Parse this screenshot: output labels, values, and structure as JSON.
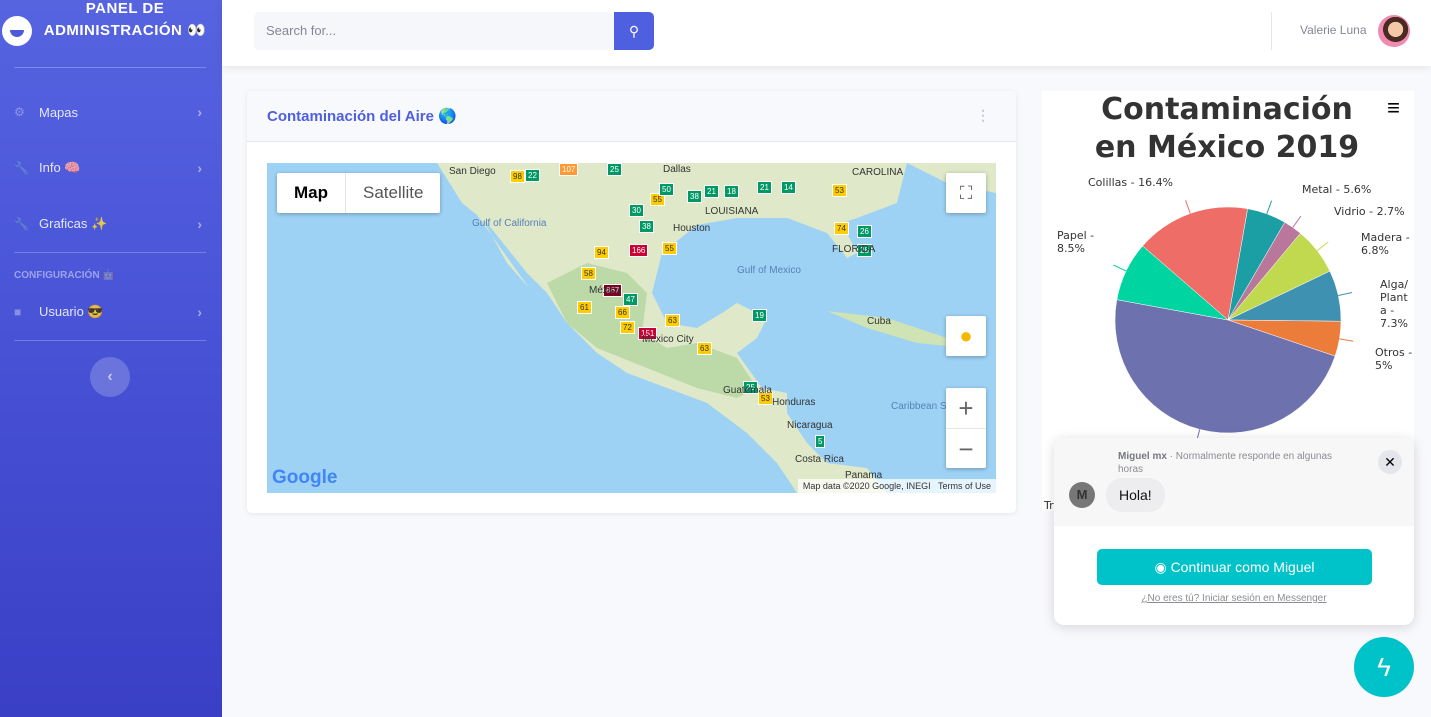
{
  "sidebar": {
    "brand": "PANEL DE ADMINISTRACIÓN 👀",
    "items": [
      {
        "label": "Mapas",
        "icon": "gear-icon"
      },
      {
        "label": "Info 🧠",
        "icon": "wrench-icon"
      },
      {
        "label": "Graficas ✨",
        "icon": "wrench-icon"
      },
      {
        "label": "Usuario 😎",
        "icon": "folder-icon"
      }
    ],
    "heading": "CONFIGURACIÓN 🤖",
    "toggle": "‹"
  },
  "topbar": {
    "search_placeholder": "Search for...",
    "user": "Valerie Luna"
  },
  "map_card": {
    "title": "Contaminación del Aire 🌎",
    "map_types": [
      "Map",
      "Satellite"
    ],
    "zoom_in": "+",
    "zoom_out": "−",
    "attribution": "Map data ©2020 Google, INEGI",
    "terms": "Terms of Use",
    "google": "Google",
    "places": [
      [
        "San Diego",
        182,
        3,
        ""
      ],
      [
        "Dallas",
        396,
        1,
        ""
      ],
      [
        "Houston",
        406,
        60,
        ""
      ],
      [
        "LOUISIANA",
        438,
        43,
        ""
      ],
      [
        "CAROLINA",
        585,
        4,
        ""
      ],
      [
        "FLORIDA",
        565,
        81,
        ""
      ],
      [
        "Gulf of California",
        205,
        55,
        "water"
      ],
      [
        "Gulf of Mexico",
        470,
        102,
        "water"
      ],
      [
        "Cuba",
        600,
        153,
        ""
      ],
      [
        "Guatemala",
        456,
        222,
        ""
      ],
      [
        "Honduras",
        505,
        234,
        ""
      ],
      [
        "Nicaragua",
        520,
        257,
        ""
      ],
      [
        "Costa Rica",
        528,
        291,
        ""
      ],
      [
        "Panama",
        578,
        307,
        ""
      ],
      [
        "Caribbean Sea",
        624,
        238,
        "water"
      ],
      [
        "Mexico City",
        375,
        171,
        ""
      ],
      [
        "México",
        322,
        122,
        ""
      ]
    ],
    "markers": [
      [
        "98",
        243,
        7,
        "#ffcc00"
      ],
      [
        "22",
        258,
        6,
        "#009966"
      ],
      [
        "107",
        292,
        0,
        "#ff9933"
      ],
      [
        "25",
        340,
        0,
        "#009966"
      ],
      [
        "50",
        392,
        20,
        "#009966"
      ],
      [
        "55",
        383,
        30,
        "#ffcc00"
      ],
      [
        "38",
        420,
        27,
        "#009966"
      ],
      [
        "21",
        437,
        22,
        "#009966"
      ],
      [
        "18",
        457,
        22,
        "#009966"
      ],
      [
        "21",
        490,
        18,
        "#009966"
      ],
      [
        "14",
        514,
        18,
        "#009966"
      ],
      [
        "53",
        565,
        21,
        "#ffcc00"
      ],
      [
        "30",
        362,
        41,
        "#009966"
      ],
      [
        "74",
        567,
        59,
        "#ffcc00"
      ],
      [
        "26",
        590,
        62,
        "#009966"
      ],
      [
        "28",
        590,
        81,
        "#009966"
      ],
      [
        "38",
        372,
        57,
        "#009966"
      ],
      [
        "55",
        395,
        79,
        "#ffcc00"
      ],
      [
        "94",
        327,
        83,
        "#ffcc00"
      ],
      [
        "166",
        362,
        81,
        "#cc0033"
      ],
      [
        "58",
        314,
        104,
        "#ffcc00"
      ],
      [
        "867",
        336,
        121,
        "#7e0023"
      ],
      [
        "47",
        356,
        130,
        "#009966"
      ],
      [
        "61",
        310,
        138,
        "#ffcc00"
      ],
      [
        "66",
        348,
        143,
        "#ffcc00"
      ],
      [
        "72",
        353,
        158,
        "#ffcc00"
      ],
      [
        "151",
        371,
        164,
        "#cc0033"
      ],
      [
        "63",
        398,
        151,
        "#ffcc00"
      ],
      [
        "63",
        430,
        179,
        "#ffcc00"
      ],
      [
        "19",
        485,
        146,
        "#009966"
      ],
      [
        "25",
        476,
        218,
        "#009966"
      ],
      [
        "53",
        491,
        229,
        "#ffcc00"
      ],
      [
        "5",
        548,
        272,
        "#009966"
      ]
    ]
  },
  "chart_data": {
    "type": "pie",
    "title": "Contaminación en México 2019",
    "slices": [
      {
        "name": "Metal",
        "value": 5.6,
        "label": "Metal - 5.6%",
        "color": "#1b9fa4"
      },
      {
        "name": "Vidrio",
        "value": 2.7,
        "label": "Vidrio - 2.7%",
        "color": "#b8779b"
      },
      {
        "name": "Madera",
        "value": 6.8,
        "label": "Madera - 6.8%",
        "color": "#c1d94f"
      },
      {
        "name": "Alga/Planta",
        "value": 7.3,
        "label": "Alga/Planta - 7.3%",
        "color": "#3e91b0"
      },
      {
        "name": "Otros",
        "value": 5,
        "label": "Otros - 5%",
        "color": "#ec7c3a"
      },
      {
        "name": "Tr",
        "value": 47.7,
        "label": "Tr",
        "color": "#6d71ae"
      },
      {
        "name": "Papel",
        "value": 8.5,
        "label": "Papel - 8.5%",
        "color": "#00d4a0"
      },
      {
        "name": "Colillas",
        "value": 16.4,
        "label": "Colillas - 16.4%",
        "color": "#ee6e67"
      }
    ]
  },
  "chat": {
    "name": "Miguel mx",
    "status": " · Normalmente responde en algunas horas",
    "avatar": "M",
    "message": "Hola!",
    "button": "Continuar como Miguel",
    "link": "¿No eres tú? Iniciar sesión en Messenger"
  }
}
